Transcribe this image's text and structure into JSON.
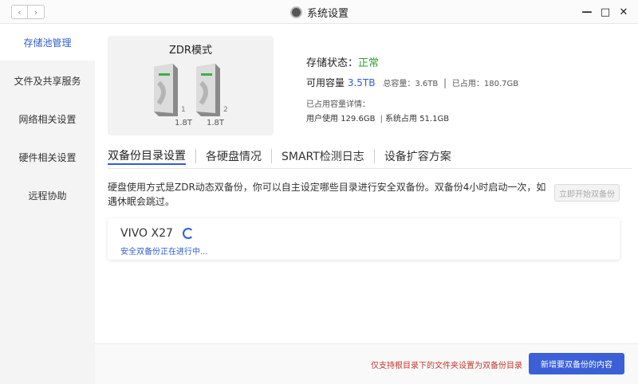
{
  "window": {
    "title": "系统设置",
    "back_icon": "‹",
    "forward_icon": "›",
    "minimize_icon": "—",
    "maximize_icon": "□",
    "close_icon": "✕"
  },
  "sidebar": {
    "items": [
      {
        "label": "存储池管理",
        "active": true
      },
      {
        "label": "文件及共享服务",
        "active": false
      },
      {
        "label": "网络相关设置",
        "active": false
      },
      {
        "label": "硬件相关设置",
        "active": false
      },
      {
        "label": "远程协助",
        "active": false
      }
    ]
  },
  "zdr_card": {
    "title": "ZDR模式",
    "drives": [
      {
        "slot": "1",
        "size": "1.8T"
      },
      {
        "slot": "2",
        "size": "1.8T"
      }
    ]
  },
  "status": {
    "state_label": "存储状态：",
    "state_value": "正常",
    "avail_label": "可用容量",
    "avail_value": "3.5TB",
    "total_label": "总容量：",
    "total_value": "3.6TB",
    "used_label": "已占用：",
    "used_value": "180.7GB",
    "detail_label": "已占用容量详情：",
    "user_used_label": "用户使用",
    "user_used_value": "129.6GB",
    "system_used_label": "系统占用",
    "system_used_value": "51.1GB"
  },
  "tabs": [
    {
      "label": "双备份目录设置",
      "active": true
    },
    {
      "label": "各硬盘情况",
      "active": false
    },
    {
      "label": "SMART检测日志",
      "active": false
    },
    {
      "label": "设备扩容方案",
      "active": false
    }
  ],
  "description": "硬盘使用方式是ZDR动态双备份，你可以自主设定哪些目录进行安全双备份。双备份4小时启动一次，如遇休眠会跳过。",
  "start_backup_button": "立即开始双备份",
  "device": {
    "name": "VIVO X27",
    "status": "安全双备份正在进行中..."
  },
  "footer": {
    "note": "仅支持根目录下的文件夹设置为双备份目录",
    "add_button": "新增要双备份的内容"
  },
  "colors": {
    "accent": "#2f5fcf",
    "primary_button": "#3a5fd6",
    "ok": "#2e9e2e",
    "warning": "#c0392b"
  }
}
